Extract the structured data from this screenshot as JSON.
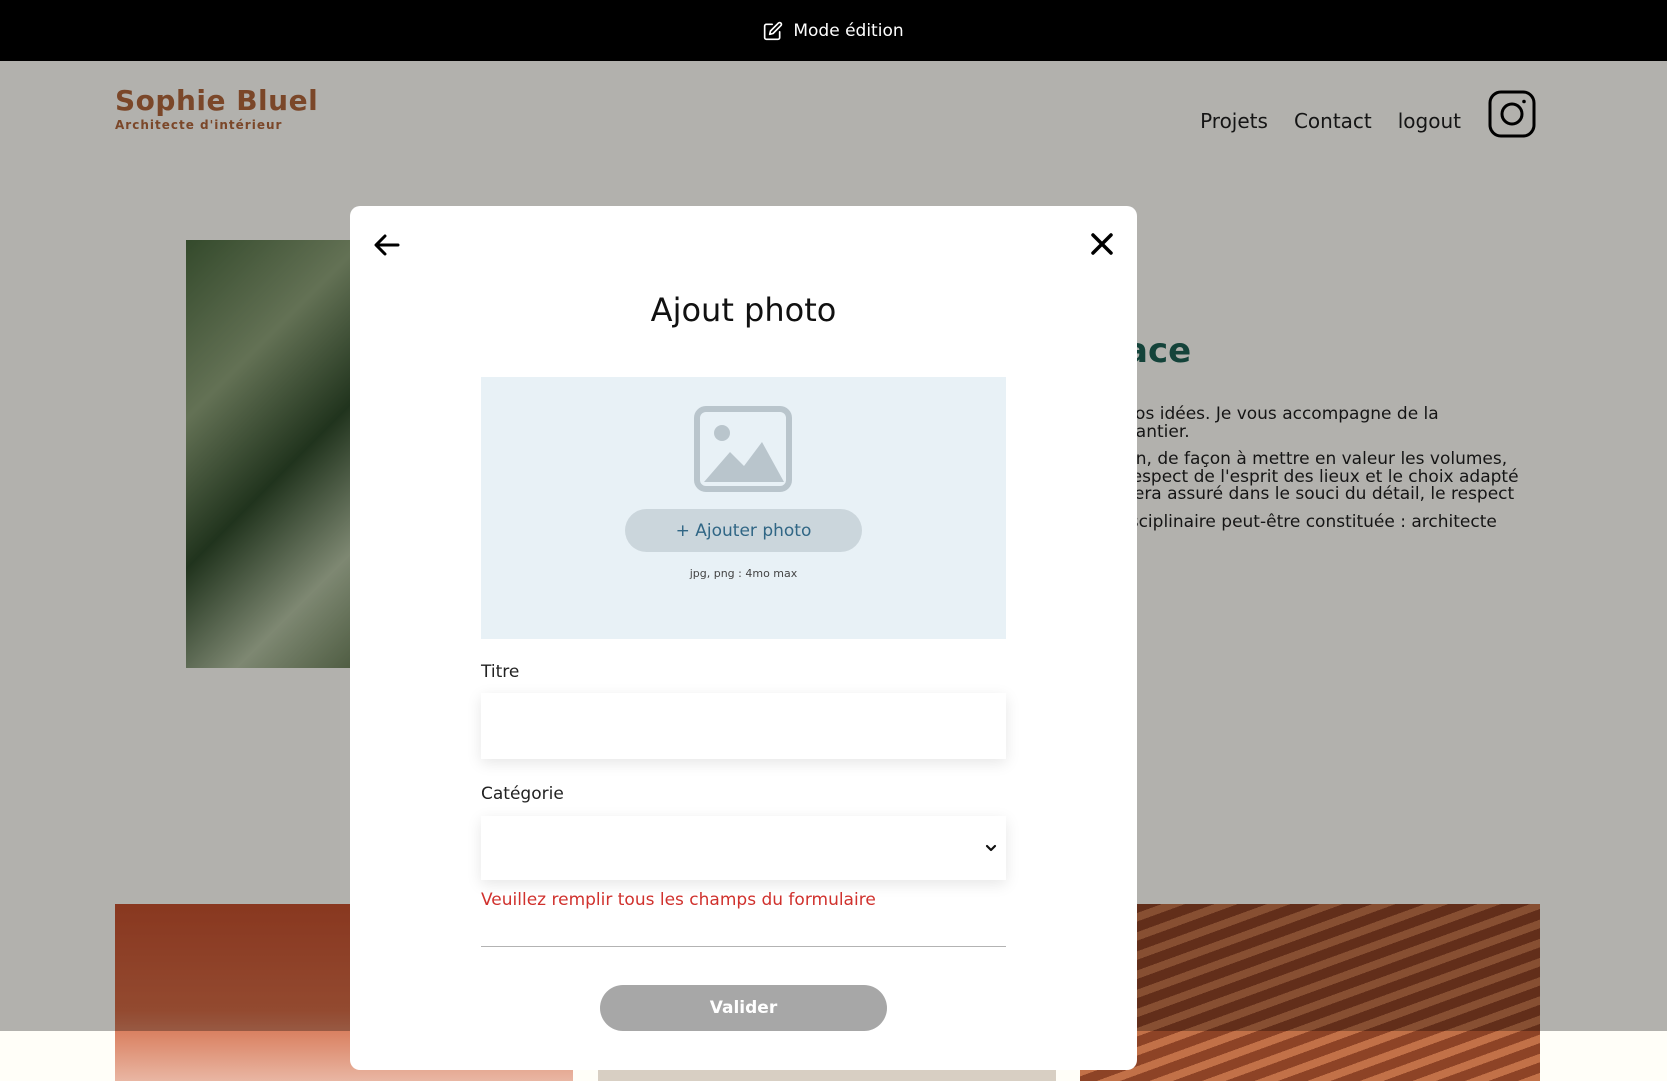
{
  "edit_bar": {
    "label": "Mode édition",
    "icon": "edit-icon"
  },
  "header": {
    "logo_title": "Sophie Bluel",
    "logo_subtitle": "Architecte d'intérieur",
    "nav": [
      "Projets",
      "Contact",
      "logout"
    ],
    "social_icon": "instagram-icon"
  },
  "intro": {
    "title_fragment": "ace",
    "paragraphs": [
      "vos idées. Je vous accompagne de la\nhantier.",
      "un, de façon à mettre en valeur les volumes,\nrespect de l'esprit des lieux et le choix adapté\nsera assuré dans le souci du détail, le respect",
      "isciplinaire peut-être constituée : architecte"
    ]
  },
  "modal": {
    "title": "Ajout photo",
    "back_icon": "arrow-left-icon",
    "close_icon": "close-icon",
    "upload": {
      "placeholder_icon": "image-icon",
      "button_label": "+ Ajouter photo",
      "hint": "jpg, png : 4mo max"
    },
    "title_label": "Titre",
    "title_value": "",
    "category_label": "Catégorie",
    "category_value": "",
    "error_message": "Veuillez remplir tous les champs du formulaire",
    "submit_label": "Valider"
  },
  "colors": {
    "brand": "#B1663C",
    "accent": "#1D6154",
    "error": "#D0312D",
    "dropzone_bg": "#E8F1F6",
    "button_disabled": "#A7A7A7"
  }
}
